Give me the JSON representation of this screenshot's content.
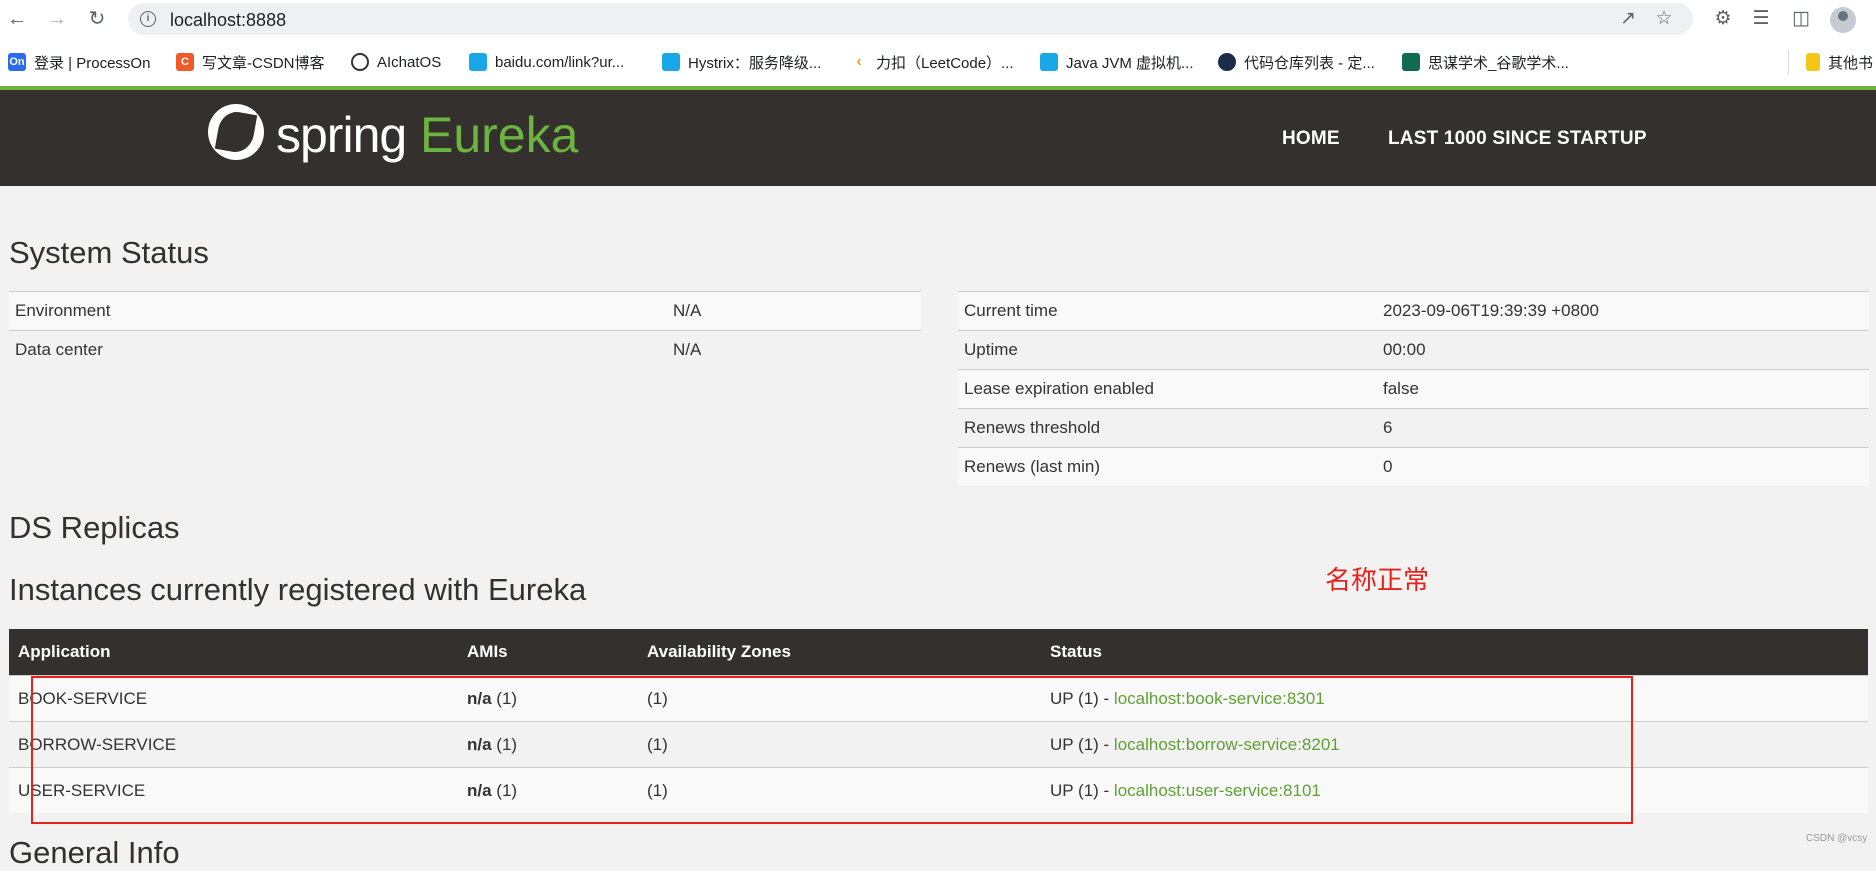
{
  "browser": {
    "url": "localhost:8888",
    "bookmarks": [
      {
        "label": "登录 | ProcessOn",
        "icon": "On",
        "color": "#2c6bed"
      },
      {
        "label": "写文章-CSDN博客",
        "icon": "C",
        "color": "#f05a28"
      },
      {
        "label": "AIchatOS",
        "icon": "",
        "color": "#333333"
      },
      {
        "label": "baidu.com/link?ur...",
        "icon": "",
        "color": "#1aa7e8"
      },
      {
        "label": "Hystrix：服务降级...",
        "icon": "",
        "color": "#1aa7e8"
      },
      {
        "label": "力扣（LeetCode）...",
        "icon": "",
        "color": "#f89f1b"
      },
      {
        "label": "Java JVM 虚拟机...",
        "icon": "",
        "color": "#1aa7e8"
      },
      {
        "label": "代码仓库列表 - 定...",
        "icon": "",
        "color": "#1d2a4a"
      },
      {
        "label": "思谋学术_谷歌学术...",
        "icon": "",
        "color": "#0f6b52"
      },
      {
        "label": "其他书",
        "icon": "",
        "color": "#f5c518"
      }
    ]
  },
  "nav": {
    "logo_spring": "spring",
    "logo_eureka": "Eureka",
    "home": "HOME",
    "last1000": "LAST 1000 SINCE STARTUP"
  },
  "system_status": {
    "title": "System Status",
    "left": [
      {
        "label": "Environment",
        "value": "N/A"
      },
      {
        "label": "Data center",
        "value": "N/A"
      }
    ],
    "right": [
      {
        "label": "Current time",
        "value": "2023-09-06T19:39:39 +0800"
      },
      {
        "label": "Uptime",
        "value": "00:00"
      },
      {
        "label": "Lease expiration enabled",
        "value": "false"
      },
      {
        "label": "Renews threshold",
        "value": "6"
      },
      {
        "label": "Renews (last min)",
        "value": "0"
      }
    ]
  },
  "ds_replicas": {
    "title": "DS Replicas"
  },
  "instances": {
    "title": "Instances currently registered with Eureka",
    "headers": [
      "Application",
      "AMIs",
      "Availability Zones",
      "Status"
    ],
    "rows": [
      {
        "app": "BOOK-SERVICE",
        "ami_bold": "n/a",
        "ami_count": "(1)",
        "zones": "(1)",
        "status": "UP (1) - ",
        "link": "localhost:book-service:8301"
      },
      {
        "app": "BORROW-SERVICE",
        "ami_bold": "n/a",
        "ami_count": "(1)",
        "zones": "(1)",
        "status": "UP (1) - ",
        "link": "localhost:borrow-service:8201"
      },
      {
        "app": "USER-SERVICE",
        "ami_bold": "n/a",
        "ami_count": "(1)",
        "zones": "(1)",
        "status": "UP (1) - ",
        "link": "localhost:user-service:8101"
      }
    ]
  },
  "annotation": {
    "text": "名称正常",
    "color": "#e5231a"
  },
  "general_info": {
    "title": "General Info"
  },
  "watermark": "CSDN @vcsy"
}
